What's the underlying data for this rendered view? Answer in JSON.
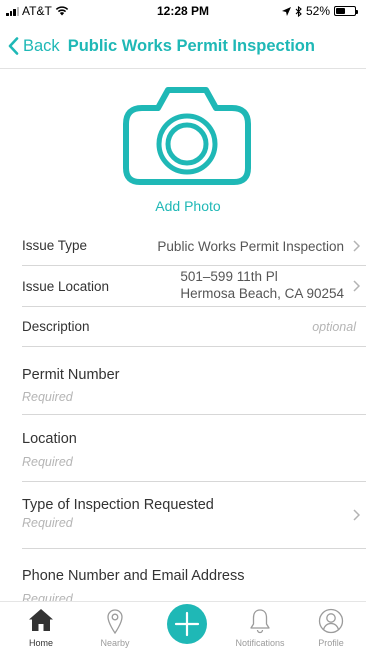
{
  "status_bar": {
    "carrier": "AT&T",
    "time": "12:28 PM",
    "battery": "52%",
    "battery_level": 0.52
  },
  "nav": {
    "back_label": "Back",
    "title": "Public Works Permit Inspection"
  },
  "photo": {
    "add_label": "Add Photo",
    "icon": "camera-icon"
  },
  "summary_rows": {
    "issue_type": {
      "label": "Issue Type",
      "value": "Public Works Permit Inspection"
    },
    "issue_location": {
      "label": "Issue Location",
      "line1": "501–599 11th Pl",
      "line2": "Hermosa Beach, CA 90254"
    },
    "description": {
      "label": "Description",
      "placeholder": "optional"
    }
  },
  "fields": {
    "permit_number": {
      "label": "Permit Number",
      "placeholder": "Required"
    },
    "location": {
      "label": "Location",
      "placeholder": "Required"
    },
    "inspection_type": {
      "label": "Type of Inspection Requested",
      "placeholder": "Required"
    },
    "contact": {
      "label": "Phone Number and Email Address",
      "placeholder": "Required"
    }
  },
  "tab_bar": {
    "home": "Home",
    "nearby": "Nearby",
    "notifications": "Notifications",
    "profile": "Profile"
  },
  "colors": {
    "accent": "#1fb8b6",
    "placeholder": "#b5b5b5"
  }
}
